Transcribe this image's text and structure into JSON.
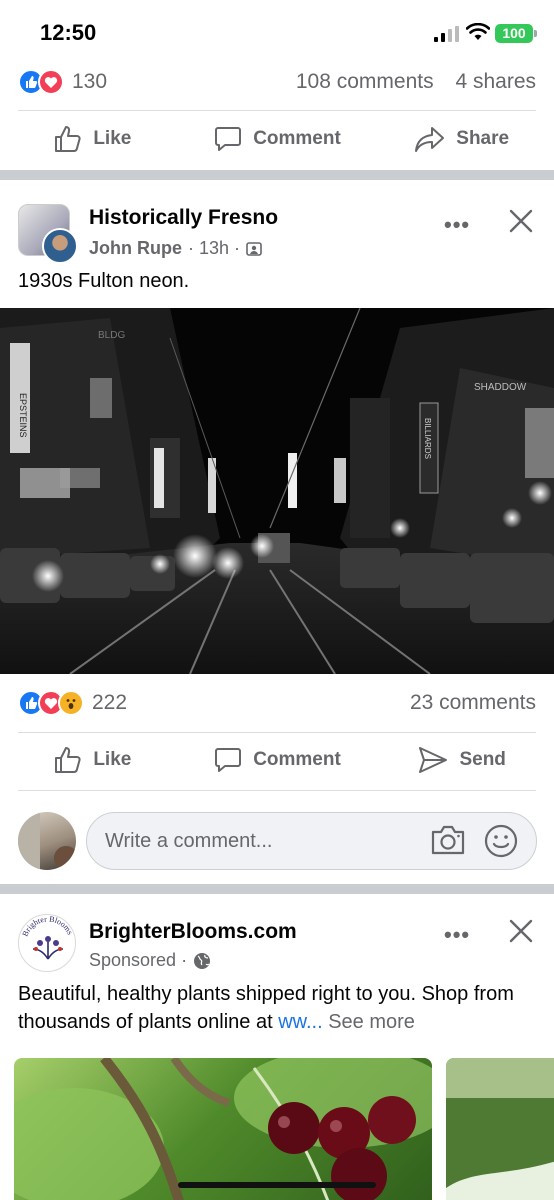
{
  "status_bar": {
    "time": "12:50",
    "battery": "100"
  },
  "prev_post": {
    "reaction_count": "130",
    "comments": "108 comments",
    "shares": "4 shares",
    "actions": {
      "like": "Like",
      "comment": "Comment",
      "share": "Share"
    }
  },
  "post": {
    "group_name": "Historically Fresno",
    "author": "John Rupe",
    "meta": "· 13h ·",
    "text": "1930s Fulton neon.",
    "photo_signs": {
      "left": "EPSTEINS",
      "right": "BILLIARDS",
      "top_right": "SHADDOW",
      "top_left": "BLDG"
    },
    "reaction_count": "222",
    "comments": "23 comments",
    "actions": {
      "like": "Like",
      "comment": "Comment",
      "send": "Send"
    }
  },
  "comment_box": {
    "placeholder": "Write a comment..."
  },
  "ad": {
    "brand": "BrighterBlooms.com",
    "logo_text": "Brighter Blooms",
    "sponsored": "Sponsored ·",
    "text": "Beautiful, healthy plants shipped right to you. Shop from thousands of plants online at ",
    "link_text": "ww...",
    "see_more": "See more"
  },
  "colors": {
    "like_blue": "#1877f2",
    "love_red": "#f33e58",
    "wow_yellow": "#f7b125",
    "divider": "#c9ccd1",
    "muted": "#65676b"
  }
}
